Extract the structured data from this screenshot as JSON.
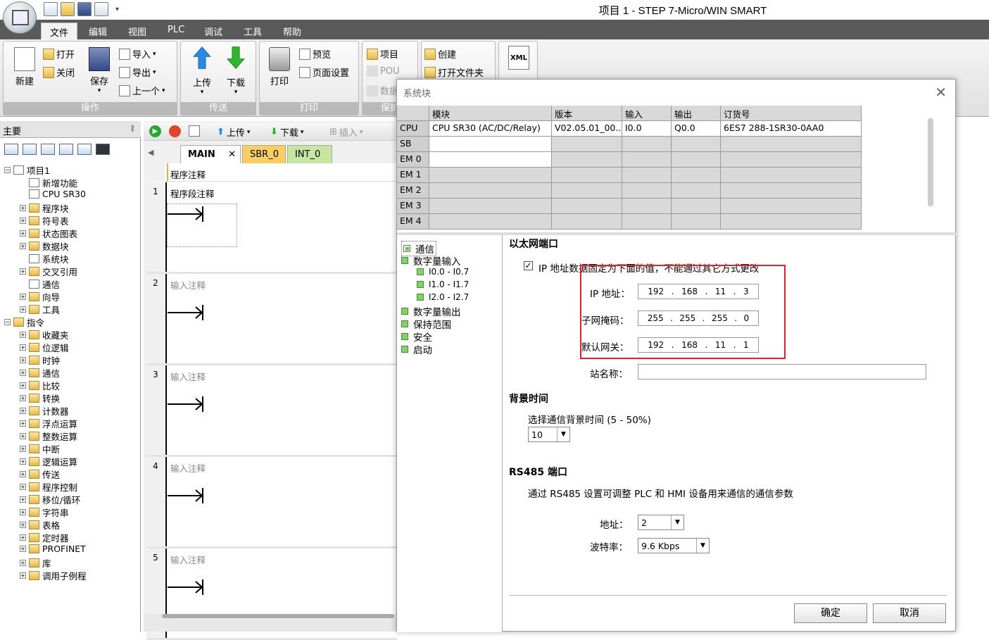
{
  "window_title": "项目 1 - STEP 7-Micro/WIN SMART",
  "menu": [
    "文件",
    "编辑",
    "视图",
    "PLC",
    "调试",
    "工具",
    "帮助"
  ],
  "ribbon": {
    "groups": [
      {
        "label": "操作",
        "buttons": {
          "new": "新建",
          "open": "打开",
          "close": "关闭",
          "save": "保存",
          "import": "导入",
          "export": "导出",
          "prev": "上一个"
        }
      },
      {
        "label": "传送",
        "buttons": {
          "upload": "上传",
          "download": "下载"
        }
      },
      {
        "label": "打印",
        "buttons": {
          "print": "打印",
          "preview": "预览",
          "page_setup": "页面设置"
        }
      },
      {
        "label": "保护",
        "buttons": {
          "project": "项目",
          "pou": "POU",
          "data": "数据"
        }
      },
      {
        "label": "",
        "buttons": {
          "create": "创建",
          "open_folder": "打开文件夹",
          "xml": "XML"
        }
      }
    ]
  },
  "nav": {
    "title": "主要",
    "pin": "ᛒ",
    "tree": [
      "项目1",
      "新增功能",
      "CPU SR30",
      "程序块",
      "符号表",
      "状态图表",
      "数据块",
      "系统块",
      "交叉引用",
      "通信",
      "向导",
      "工具",
      "指令",
      "收藏夹",
      "位逻辑",
      "时钟",
      "通信",
      "比较",
      "转换",
      "计数器",
      "浮点运算",
      "整数运算",
      "中断",
      "逻辑运算",
      "传送",
      "程序控制",
      "移位/循环",
      "字符串",
      "表格",
      "定时器",
      "PROFINET",
      "库",
      "调用子例程"
    ]
  },
  "editor": {
    "toolbar": {
      "upload": "上传",
      "download": "下载",
      "insert": "插入"
    },
    "tabs": [
      "MAIN",
      "SBR_0",
      "INT_0"
    ],
    "tab_close": "✕",
    "program_comment": "程序注释",
    "networks": [
      {
        "num": "1",
        "comment": "程序段注释"
      },
      {
        "num": "2",
        "comment": "输入注释"
      },
      {
        "num": "3",
        "comment": "输入注释"
      },
      {
        "num": "4",
        "comment": "输入注释"
      },
      {
        "num": "5",
        "comment": "输入注释"
      }
    ]
  },
  "dialog": {
    "title": "系统块",
    "close": "✕",
    "grid": {
      "headers": [
        "",
        "模块",
        "版本",
        "输入",
        "输出",
        "订货号"
      ],
      "rows": [
        [
          "CPU",
          "CPU SR30 (AC/DC/Relay)",
          "V02.05.01_00....",
          "I0.0",
          "Q0.0",
          "6ES7 288-1SR30-0AA0"
        ],
        [
          "SB",
          "",
          "",
          "",
          "",
          ""
        ],
        [
          "EM 0",
          "",
          "",
          "",
          "",
          ""
        ],
        [
          "EM 1",
          "",
          "",
          "",
          "",
          ""
        ],
        [
          "EM 2",
          "",
          "",
          "",
          "",
          ""
        ],
        [
          "EM 3",
          "",
          "",
          "",
          "",
          ""
        ],
        [
          "EM 4",
          "",
          "",
          "",
          "",
          ""
        ]
      ]
    },
    "left_tree": [
      "通信",
      "数字量输入",
      "I0.0 - I0.7",
      "I1.0 - I1.7",
      "I2.0 - I2.7",
      "数字量输出",
      "保持范围",
      "安全",
      "启动"
    ],
    "ethernet": {
      "section": "以太网端口",
      "fixed_ip_label": "IP 地址数据固定为下面的值，不能通过其它方式更改",
      "fixed_ip_checked": true,
      "ip_label": "IP 地址：",
      "ip": [
        "192",
        "168",
        "11",
        "3"
      ],
      "mask_label": "子网掩码：",
      "mask": [
        "255",
        "255",
        "255",
        "0"
      ],
      "gateway_label": "默认网关：",
      "gateway": [
        "192",
        "168",
        "11",
        "1"
      ],
      "station_label": "站名称：",
      "station": ""
    },
    "background": {
      "section": "背景时间",
      "label": "选择通信背景时间 (5 - 50%)",
      "value": "10"
    },
    "rs485": {
      "section": "RS485 端口",
      "desc": "通过 RS485 设置可调整 PLC 和 HMI 设备用来通信的通信参数",
      "addr_label": "地址：",
      "addr": "2",
      "baud_label": "波特率：",
      "baud": "9.6 Kbps"
    },
    "ok": "确定",
    "cancel": "取消",
    "highlight_color": "#e8202a"
  }
}
